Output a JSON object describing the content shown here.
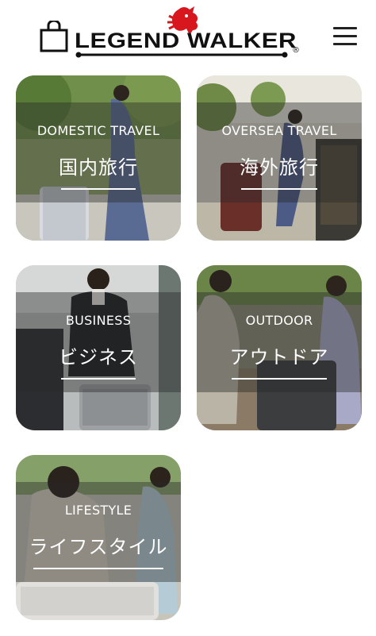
{
  "header": {
    "brand": "LEGEND WALKER",
    "reg": "®",
    "icons": {
      "bag": "shopping-bag-icon",
      "lion": "lion-emblem-icon",
      "menu": "hamburger-menu-icon"
    },
    "brand_accent": "#d8161e"
  },
  "categories": [
    {
      "en": "DOMESTIC TRAVEL",
      "jp": "国内旅行"
    },
    {
      "en": "OVERSEA TRAVEL",
      "jp": "海外旅行"
    },
    {
      "en": "BUSINESS",
      "jp": "ビジネス"
    },
    {
      "en": "OUTDOOR",
      "jp": "アウトドア"
    },
    {
      "en": "LIFESTYLE",
      "jp": "ライフスタイル"
    }
  ]
}
